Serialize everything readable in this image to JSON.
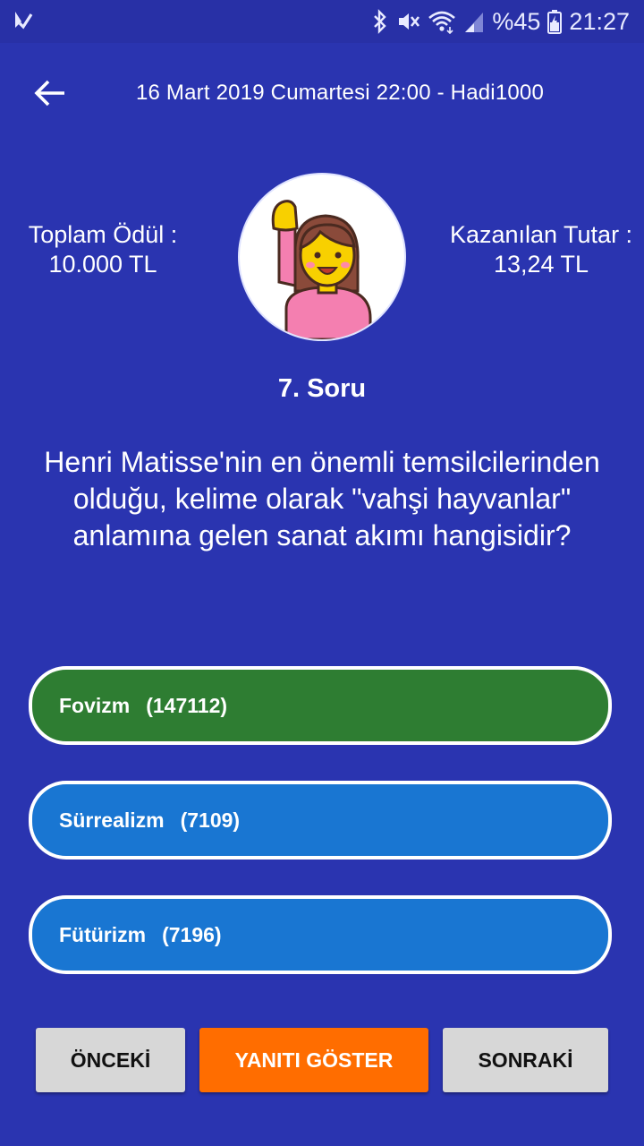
{
  "status_bar": {
    "battery_text": "%45",
    "time": "21:27",
    "icons": [
      "app-notification-icon",
      "bluetooth-icon",
      "mute-icon",
      "wifi-icon",
      "signal-icon",
      "battery-icon"
    ]
  },
  "header": {
    "title": "16 Mart 2019 Cumartesi 22:00 - Hadi1000",
    "back_icon": "arrow-left-icon"
  },
  "stats": {
    "total_prize_label": "Toplam Ödül :",
    "total_prize_value": "10.000 TL",
    "won_label": "Kazanılan Tutar :",
    "won_value": "13,24 TL"
  },
  "avatar_icon": "woman-raising-hand-icon",
  "question": {
    "number_label": "7. Soru",
    "text": "Henri Matisse'nin en önemli temsilcilerinden olduğu, kelime olarak \"vahşi hayvanlar\" anlamına gelen sanat akımı hangisidir?"
  },
  "answers": [
    {
      "label": "Fovizm",
      "count": "(147112)",
      "state": "correct",
      "color": "#2e7d32"
    },
    {
      "label": "Sürrealizm",
      "count": "(7109)",
      "state": "default",
      "color": "#1976d2"
    },
    {
      "label": "Fütürizm",
      "count": "(7196)",
      "state": "default",
      "color": "#1976d2"
    }
  ],
  "buttons": {
    "previous": "ÖNCEKİ",
    "show_answer": "YANITI GÖSTER",
    "next": "SONRAKİ"
  },
  "colors": {
    "background": "#2a34b0",
    "correct": "#2e7d32",
    "option": "#1976d2",
    "accent_button": "#ff6d00",
    "neutral_button": "#d7d7d7"
  }
}
